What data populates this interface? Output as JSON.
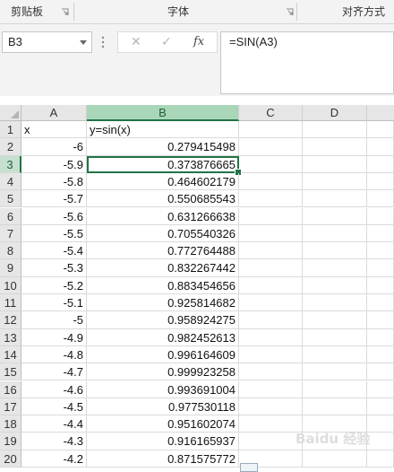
{
  "ribbon": {
    "groups": [
      {
        "label": "剪贴板"
      },
      {
        "label": "字体"
      },
      {
        "label": "对齐方式"
      }
    ]
  },
  "formula_bar": {
    "name_box": "B3",
    "formula": "=SIN(A3)",
    "cancel_icon": "✕",
    "enter_icon": "✓",
    "fx_label": "fx"
  },
  "grid": {
    "columns": [
      "A",
      "B",
      "C",
      "D"
    ],
    "selected_column": "B",
    "active_cell": "B3",
    "rows": [
      {
        "n": "1",
        "a": "x",
        "b": "y=sin(x)"
      },
      {
        "n": "2",
        "a": "-6",
        "b": "0.279415498"
      },
      {
        "n": "3",
        "a": "-5.9",
        "b": "0.373876665"
      },
      {
        "n": "4",
        "a": "-5.8",
        "b": "0.464602179"
      },
      {
        "n": "5",
        "a": "-5.7",
        "b": "0.550685543"
      },
      {
        "n": "6",
        "a": "-5.6",
        "b": "0.631266638"
      },
      {
        "n": "7",
        "a": "-5.5",
        "b": "0.705540326"
      },
      {
        "n": "8",
        "a": "-5.4",
        "b": "0.772764488"
      },
      {
        "n": "9",
        "a": "-5.3",
        "b": "0.832267442"
      },
      {
        "n": "10",
        "a": "-5.2",
        "b": "0.883454656"
      },
      {
        "n": "11",
        "a": "-5.1",
        "b": "0.925814682"
      },
      {
        "n": "12",
        "a": "-5",
        "b": "0.958924275"
      },
      {
        "n": "13",
        "a": "-4.9",
        "b": "0.982452613"
      },
      {
        "n": "14",
        "a": "-4.8",
        "b": "0.996164609"
      },
      {
        "n": "15",
        "a": "-4.7",
        "b": "0.999923258"
      },
      {
        "n": "16",
        "a": "-4.6",
        "b": "0.993691004"
      },
      {
        "n": "17",
        "a": "-4.5",
        "b": "0.977530118"
      },
      {
        "n": "18",
        "a": "-4.4",
        "b": "0.951602074"
      },
      {
        "n": "19",
        "a": "-4.3",
        "b": "0.916165937"
      },
      {
        "n": "20",
        "a": "-4.2",
        "b": "0.871575772"
      }
    ]
  },
  "watermark": "Baidu 经验",
  "colors": {
    "accent": "#217346",
    "selected_header": "#a9d6b8"
  }
}
